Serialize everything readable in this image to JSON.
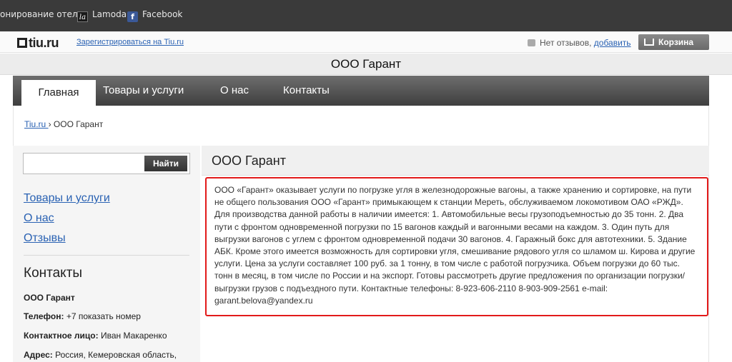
{
  "bookmarks": {
    "item1": "онирование отел",
    "item2": "Lamoda",
    "item3": "Facebook",
    "la_glyph": "la",
    "fb_glyph": "f"
  },
  "top": {
    "logo": "tiu.ru",
    "register": "Зарегистрироваться на Tiu.ru",
    "reviews_text": "Нет отзывов, ",
    "reviews_add": "добавить",
    "cart": "Корзина"
  },
  "company_title": "ООО Гарант",
  "nav": {
    "tabs": [
      {
        "label": "Главная"
      },
      {
        "label": "Товары и услуги"
      },
      {
        "label": "О нас"
      },
      {
        "label": "Контакты"
      }
    ],
    "active_tab": "Главная"
  },
  "breadcrumb": {
    "root": "Tiu.ru ",
    "separator": "›",
    "current": "ООО Гарант"
  },
  "sidebar": {
    "search_placeholder": "",
    "search_button": "Найти",
    "links": [
      {
        "label": "Товары и услуги"
      },
      {
        "label": "О нас"
      },
      {
        "label": "Отзывы"
      }
    ],
    "contacts_title": "Контакты",
    "company": "ООО Гарант",
    "phone_label": "Телефон:",
    "phone_value": "+7 показать номер",
    "person_label": "Контактное лицо:",
    "person_value": "Иван Макаренко",
    "address_label": "Адрес:",
    "address_value": "Россия, Кемеровская область,"
  },
  "main": {
    "title": "ООО Гарант",
    "description": "ООО «Гарант» оказывает услуги по погрузке угля в железнодорожные вагоны, а также хранению и сортировке, на пути не общего пользования ООО «Гарант» примыкающем к станции Мереть, обслуживаемом локомотивом ОАО «РЖД». Для производства данной работы в наличии имеется: 1. Автомобильные весы грузоподъемностью до 35 тонн. 2. Два пути с фронтом одновременной погрузки по 15 вагонов каждый и вагонными весами на каждом. 3. Один путь для выгрузки вагонов с углем с фронтом одновременной подачи 30 вагонов. 4. Гаражный бокс для автотехники. 5. Здание АБК. Кроме этого имеется возможность для сортировки угля, смешивание рядового угля со шламом ш. Кирова и другие услуги. Цена за услуги составляет 100 руб. за 1 тонну, в том числе с работой погрузчика. Объем погрузки до 60 тыс. тонн в месяц, в том числе по России и на экспорт. Готовы рассмотреть другие предложения по организации погрузки/выгрузки грузов с подъездного пути. Контактные телефоны: 8-923-606-2110 8-903-909-2561 e-mail: garant.belova@yandex.ru"
  },
  "colors": {
    "accent_link": "#2a62b3",
    "highlight_border": "#e21a1a",
    "nav_bg": "#555555"
  }
}
